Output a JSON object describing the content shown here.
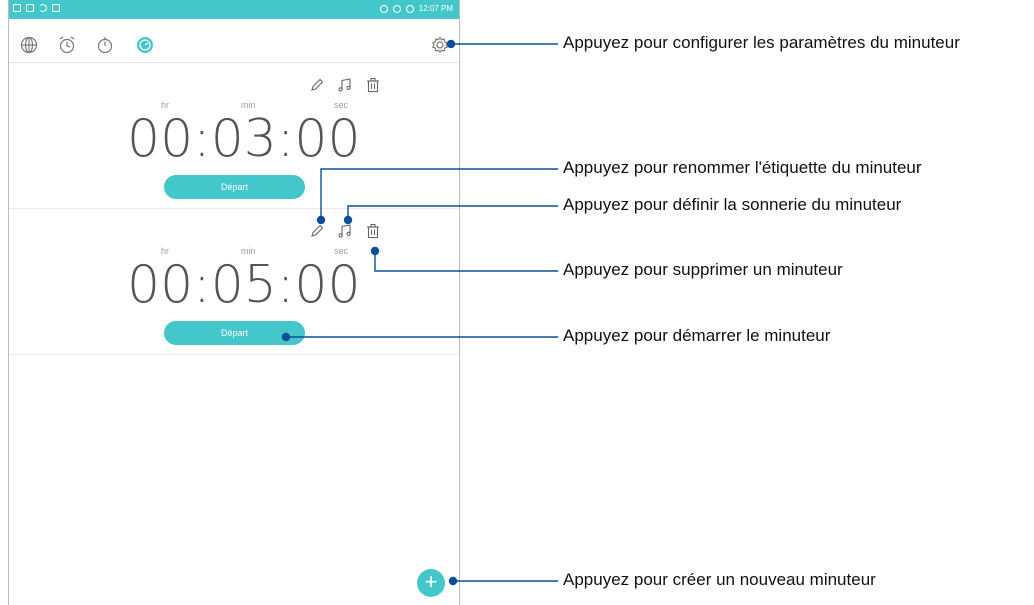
{
  "status_bar": {
    "time": "12:07 PM"
  },
  "tabs": [
    {
      "name": "world-clock",
      "icon": "globe-icon"
    },
    {
      "name": "alarm",
      "icon": "alarm-clock-icon"
    },
    {
      "name": "stopwatch",
      "icon": "stopwatch-icon"
    },
    {
      "name": "timer",
      "icon": "timer-icon",
      "active": true
    }
  ],
  "timers": [
    {
      "unit_hr": "hr",
      "unit_min": "min",
      "unit_sec": "sec",
      "time": "00:03:00",
      "start_label": "Départ"
    },
    {
      "unit_hr": "hr",
      "unit_min": "min",
      "unit_sec": "sec",
      "time": "00:05:00",
      "start_label": "Départ"
    }
  ],
  "fab_label": "+",
  "callouts": {
    "settings": "Appuyez pour configurer les paramètres du minuteur",
    "rename": "Appuyez pour renommer l'étiquette du minuteur",
    "ringtone": "Appuyez pour définir la sonnerie du minuteur",
    "delete": "Appuyez pour supprimer un minuteur",
    "start": "Appuyez pour démarrer le minuteur",
    "create": "Appuyez pour créer un nouveau minuteur"
  },
  "colors": {
    "accent": "#43c7cb",
    "callout_line": "#0b4f9c"
  }
}
